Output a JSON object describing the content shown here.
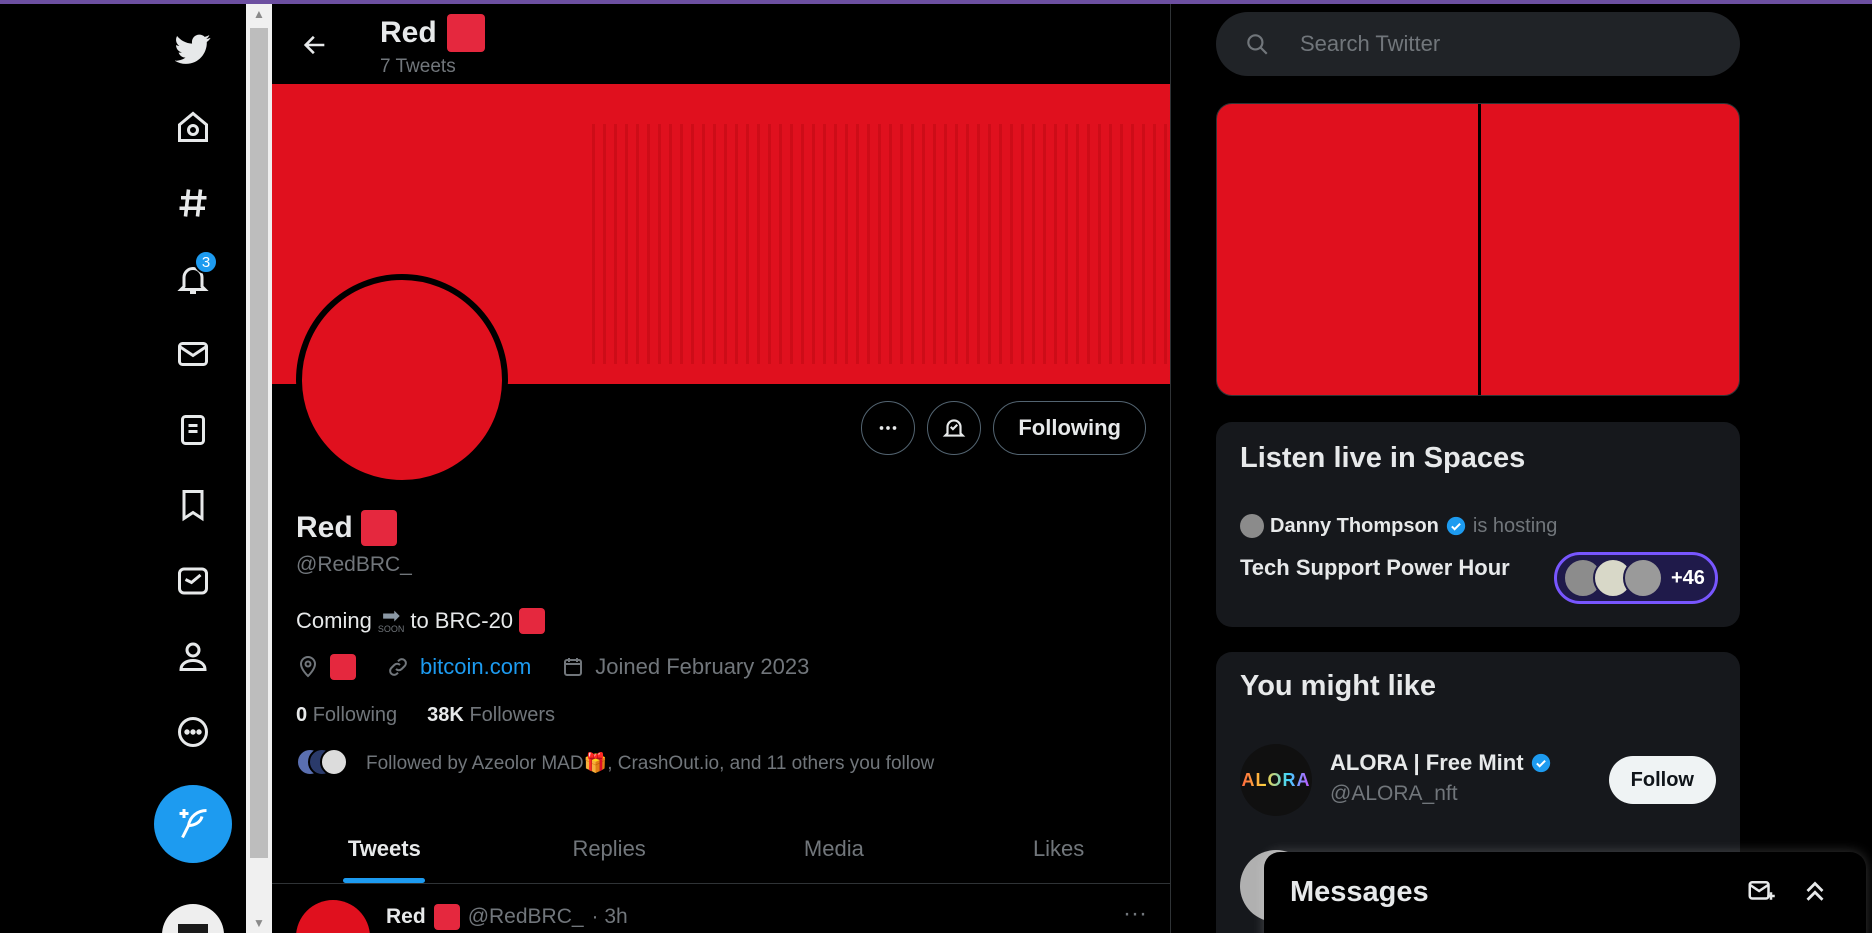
{
  "colors": {
    "accent": "#1d9bf0",
    "brand_red": "#e0101e",
    "background": "#000000",
    "muted_text": "#71767b",
    "spaces_purple": "#7856ff"
  },
  "nav": {
    "items": [
      {
        "name": "twitter-logo-icon"
      },
      {
        "name": "home-icon"
      },
      {
        "name": "explore-hashtag-icon"
      },
      {
        "name": "notifications-bell-icon"
      },
      {
        "name": "messages-envelope-icon"
      },
      {
        "name": "lists-icon"
      },
      {
        "name": "bookmarks-icon"
      },
      {
        "name": "twitter-blue-icon"
      },
      {
        "name": "profile-icon"
      },
      {
        "name": "more-circle-icon"
      }
    ],
    "notifications_badge": "3",
    "tweet_button_icon": "feather-plus-icon"
  },
  "header": {
    "name": "Red",
    "tweet_count": "7 Tweets"
  },
  "profile": {
    "name": "Red",
    "handle": "@RedBRC_",
    "bio_prefix": "Coming",
    "bio_soon": "SOON",
    "bio_suffix": "to BRC-20",
    "website": "bitcoin.com",
    "joined": "Joined February 2023",
    "following_count": "0",
    "following_label": "Following",
    "followers_count": "38K",
    "followers_label": "Followers",
    "followed_by": "Followed by Azeolor MAD🎁, CrashOut.io, and 11 others you follow",
    "following_button": "Following"
  },
  "tabs": [
    {
      "label": "Tweets",
      "active": true
    },
    {
      "label": "Replies",
      "active": false
    },
    {
      "label": "Media",
      "active": false
    },
    {
      "label": "Likes",
      "active": false
    }
  ],
  "tweet": {
    "name": "Red",
    "handle": "@RedBRC_",
    "time": "· 3h"
  },
  "search": {
    "placeholder": "Search Twitter"
  },
  "spaces": {
    "title": "Listen live in Spaces",
    "host": "Danny Thompson",
    "host_status": "is hosting",
    "space_title": "Tech Support Power Hour",
    "listener_extra": "+46"
  },
  "might_like": {
    "title": "You might like",
    "suggestions": [
      {
        "name": "ALORA | Free Mint",
        "handle": "@ALORA_nft",
        "avatar_text": "ALORA",
        "button": "Follow"
      }
    ]
  },
  "messages": {
    "title": "Messages"
  }
}
